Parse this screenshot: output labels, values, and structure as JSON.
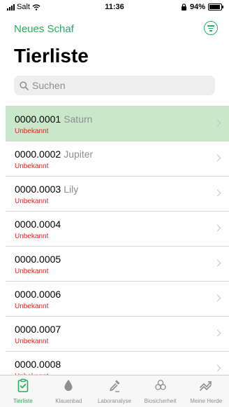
{
  "status_bar": {
    "carrier": "Salt",
    "time": "11:36",
    "battery": "94%",
    "battery_level": 0.94
  },
  "header": {
    "new_sheep": "Neues Schaf",
    "title": "Tierliste"
  },
  "search": {
    "placeholder": "Suchen"
  },
  "animals": [
    {
      "id": "0000.0001",
      "name": "Saturn",
      "status": "Unbekannt",
      "selected": true
    },
    {
      "id": "0000.0002",
      "name": "Jupiter",
      "status": "Unbekannt",
      "selected": false
    },
    {
      "id": "0000.0003",
      "name": "Lily",
      "status": "Unbekannt",
      "selected": false
    },
    {
      "id": "0000.0004",
      "name": "",
      "status": "Unbekannt",
      "selected": false
    },
    {
      "id": "0000.0005",
      "name": "",
      "status": "Unbekannt",
      "selected": false
    },
    {
      "id": "0000.0006",
      "name": "",
      "status": "Unbekannt",
      "selected": false
    },
    {
      "id": "0000.0007",
      "name": "",
      "status": "Unbekannt",
      "selected": false
    },
    {
      "id": "0000.0008",
      "name": "",
      "status": "Unbekannt",
      "selected": false
    }
  ],
  "tabs": [
    {
      "label": "Tierliste",
      "icon": "clipboard-check-icon",
      "active": true
    },
    {
      "label": "Klauenbad",
      "icon": "drop-icon",
      "active": false
    },
    {
      "label": "Laboranalyse",
      "icon": "pipette-icon",
      "active": false
    },
    {
      "label": "Biosicherheit",
      "icon": "biohazard-icon",
      "active": false
    },
    {
      "label": "Meine Herde",
      "icon": "trend-arrows-icon",
      "active": false
    }
  ],
  "colors": {
    "accent": "#27ae60",
    "selected_row": "#c9e8c9",
    "status_red": "#e02424",
    "inactive_gray": "#8e8e93"
  }
}
